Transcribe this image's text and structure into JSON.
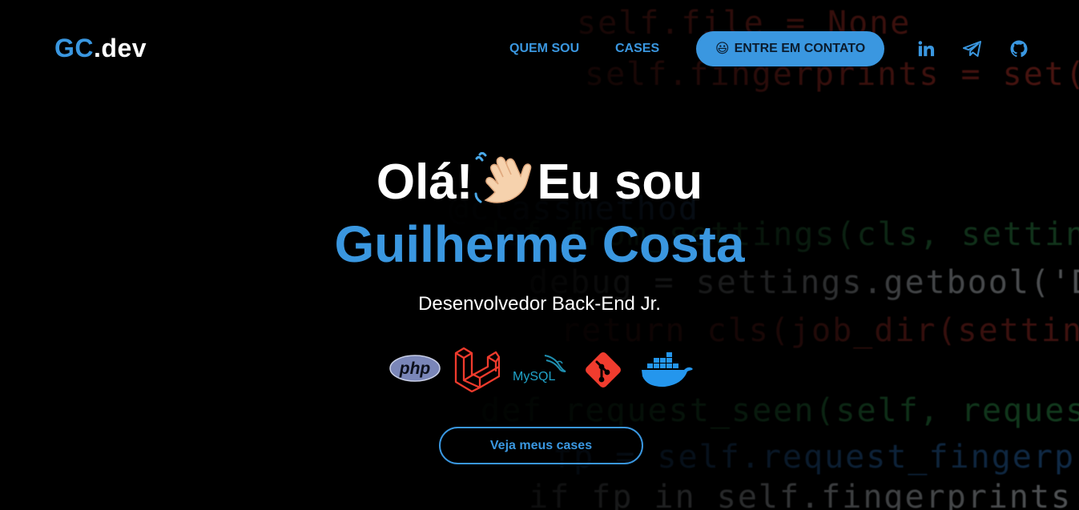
{
  "header": {
    "logo_main": "GC",
    "logo_suffix": ".dev",
    "nav": [
      {
        "label": "QUEM SOU"
      },
      {
        "label": "CASES"
      }
    ],
    "contact_button": {
      "emoji": "😃",
      "label": "ENTRE EM CONTATO"
    },
    "social": [
      {
        "icon": "linkedin-icon"
      },
      {
        "icon": "telegram-icon"
      },
      {
        "icon": "github-icon"
      }
    ]
  },
  "hero": {
    "greeting": "Olá!",
    "wave_icon": "waving-hand-icon",
    "intro": "Eu sou",
    "name": "Guilherme Costa",
    "role": "Desenvolvedor Back-End Jr."
  },
  "tech_stack": [
    {
      "icon": "php-icon",
      "label": "php"
    },
    {
      "icon": "laravel-icon"
    },
    {
      "icon": "mysql-icon",
      "label": "MySQL"
    },
    {
      "icon": "git-icon"
    },
    {
      "icon": "docker-icon"
    }
  ],
  "cta": {
    "label": "Veja meus cases"
  },
  "colors": {
    "accent": "#3a97e0",
    "background": "#000000"
  },
  "background_code": [
    "self.file = None",
    "self.fingerprints = set()",
    "@classmethod",
    "def from_settings(cls, settings):",
    "debug = settings.getbool('DUPEFILTER_DEBUG')",
    "return cls(job_dir(settings), debug)",
    "def request_seen(self, request):",
    "fp = self.request_fingerprint(request)",
    "if fp in self.fingerprints:"
  ]
}
